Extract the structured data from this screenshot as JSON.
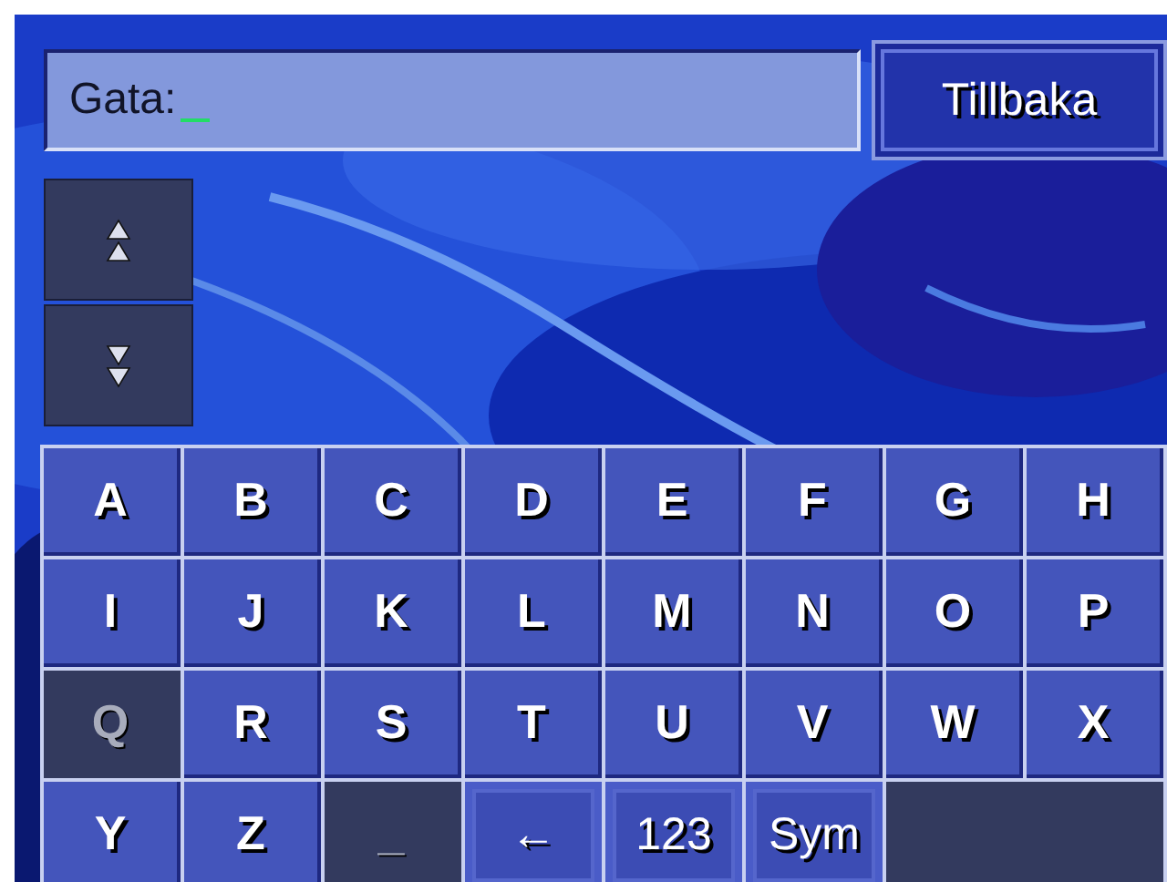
{
  "search": {
    "label": "Gata:"
  },
  "back_button": {
    "label": "Tillbaka"
  },
  "keys": [
    {
      "label": "A",
      "kind": "char",
      "disabled": false
    },
    {
      "label": "B",
      "kind": "char",
      "disabled": false
    },
    {
      "label": "C",
      "kind": "char",
      "disabled": false
    },
    {
      "label": "D",
      "kind": "char",
      "disabled": false
    },
    {
      "label": "E",
      "kind": "char",
      "disabled": false
    },
    {
      "label": "F",
      "kind": "char",
      "disabled": false
    },
    {
      "label": "G",
      "kind": "char",
      "disabled": false
    },
    {
      "label": "H",
      "kind": "char",
      "disabled": false
    },
    {
      "label": "I",
      "kind": "char",
      "disabled": false
    },
    {
      "label": "J",
      "kind": "char",
      "disabled": false
    },
    {
      "label": "K",
      "kind": "char",
      "disabled": false
    },
    {
      "label": "L",
      "kind": "char",
      "disabled": false
    },
    {
      "label": "M",
      "kind": "char",
      "disabled": false
    },
    {
      "label": "N",
      "kind": "char",
      "disabled": false
    },
    {
      "label": "O",
      "kind": "char",
      "disabled": false
    },
    {
      "label": "P",
      "kind": "char",
      "disabled": false
    },
    {
      "label": "Q",
      "kind": "char",
      "disabled": true
    },
    {
      "label": "R",
      "kind": "char",
      "disabled": false
    },
    {
      "label": "S",
      "kind": "char",
      "disabled": false
    },
    {
      "label": "T",
      "kind": "char",
      "disabled": false
    },
    {
      "label": "U",
      "kind": "char",
      "disabled": false
    },
    {
      "label": "V",
      "kind": "char",
      "disabled": false
    },
    {
      "label": "W",
      "kind": "char",
      "disabled": false
    },
    {
      "label": "X",
      "kind": "char",
      "disabled": false
    },
    {
      "label": "Y",
      "kind": "char",
      "disabled": false
    },
    {
      "label": "Z",
      "kind": "char",
      "disabled": false
    },
    {
      "label": "_",
      "kind": "char",
      "disabled": true
    },
    {
      "label": "←",
      "kind": "command",
      "disabled": false
    },
    {
      "label": "123",
      "kind": "command",
      "disabled": false
    },
    {
      "label": "Sym",
      "kind": "command",
      "disabled": false
    }
  ]
}
